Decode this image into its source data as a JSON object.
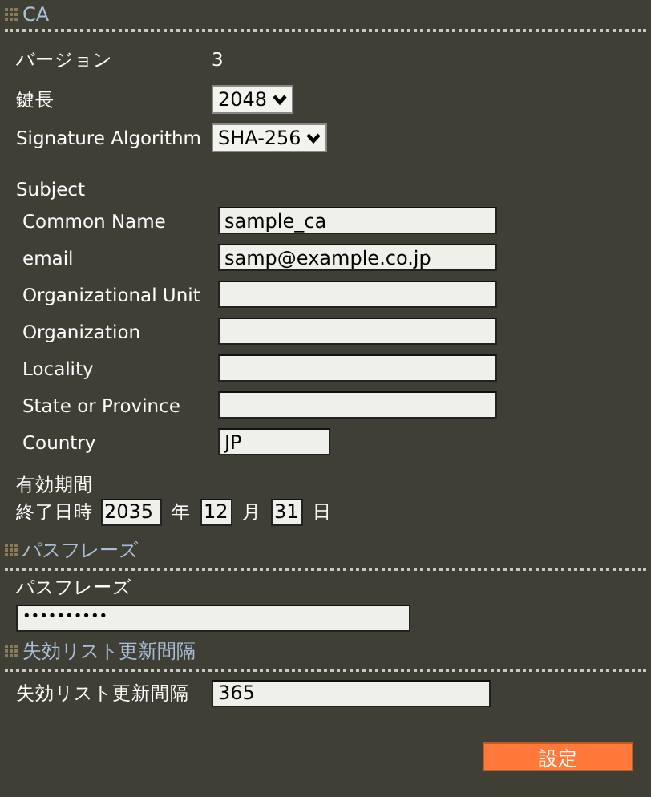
{
  "sections": [
    {
      "title": "CA",
      "version": {
        "label": "バージョン",
        "value": "3"
      },
      "selects": [
        {
          "label": "鍵長",
          "value": "2048"
        },
        {
          "label": "Signature Algorithm",
          "value": "SHA-256"
        }
      ],
      "subject": {
        "title": "Subject",
        "fields": [
          {
            "label": "Common Name",
            "value": "sample_ca",
            "kind": "wide"
          },
          {
            "label": "email",
            "value": "samp@example.co.jp",
            "kind": "wide"
          },
          {
            "label": "Organizational Unit",
            "kind": "wide"
          },
          {
            "label": "Organization",
            "kind": "wide"
          },
          {
            "label": "Locality",
            "kind": "wide"
          },
          {
            "label": "State or Province",
            "kind": "wide"
          },
          {
            "label": "Country",
            "value": "JP",
            "kind": "short"
          }
        ]
      },
      "validity": {
        "title": "有効期間",
        "label": "終了日時",
        "parts": [
          {
            "value": "2035",
            "unit": "年",
            "kind": "year"
          },
          {
            "value": "12",
            "unit": "月",
            "kind": "day"
          },
          {
            "value": "31",
            "unit": "日",
            "kind": "day"
          }
        ]
      }
    },
    {
      "title": "パスフレーズ",
      "passphrase": {
        "label": "パスフレーズ",
        "value": "••••••••••"
      }
    },
    {
      "title": "失効リスト更新間隔",
      "interval": {
        "label": "失効リスト更新間隔",
        "value": "365"
      }
    }
  ],
  "submit": "設定"
}
